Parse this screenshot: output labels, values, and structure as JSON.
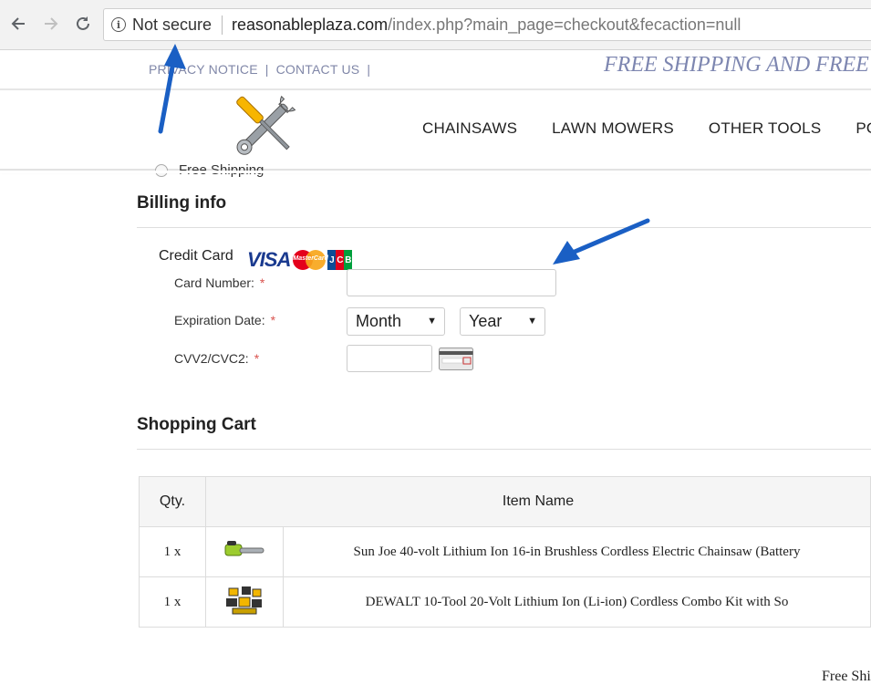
{
  "browser": {
    "back_icon": "arrow-left-icon",
    "forward_icon": "arrow-right-icon",
    "reload_icon": "reload-icon",
    "security_label": "Not secure",
    "url_domain": "reasonableplaza.com",
    "url_path": "/index.php?main_page=checkout&fecaction=null"
  },
  "topbar": {
    "links": [
      "PRIVACY NOTICE",
      "CONTACT US"
    ],
    "separator": "|",
    "promo": "FREE SHIPPING AND FREE S"
  },
  "nav": {
    "items": [
      "CHAINSAWS",
      "LAWN MOWERS",
      "OTHER TOOLS",
      "POW"
    ]
  },
  "checkout": {
    "shipping_option": "Free Shipping",
    "billing_title": "Billing info",
    "credit_card_label": "Credit Card",
    "card_brands": [
      "VISA",
      "MasterCard",
      "JCB"
    ],
    "fields": {
      "card_number_label": "Card Number:",
      "expiration_label": "Expiration Date:",
      "cvv_label": "CVV2/CVC2:",
      "required_mark": "*",
      "month_value": "Month",
      "year_value": "Year"
    }
  },
  "cart": {
    "title": "Shopping Cart",
    "headers": {
      "qty": "Qty.",
      "item": "Item Name"
    },
    "rows": [
      {
        "qty": "1 x",
        "name": "Sun Joe 40-volt Lithium Ion 16-in Brushless Cordless Electric Chainsaw (Battery"
      },
      {
        "qty": "1 x",
        "name": "DEWALT 10-Tool 20-Volt Lithium Ion (Li-ion) Cordless Combo Kit with So"
      }
    ]
  },
  "footer": {
    "free_shipping_peek": "Free Shi"
  },
  "colors": {
    "accent_link": "#8087a8",
    "annotation_arrow": "#1a5fc4",
    "required": "#d9534f"
  }
}
